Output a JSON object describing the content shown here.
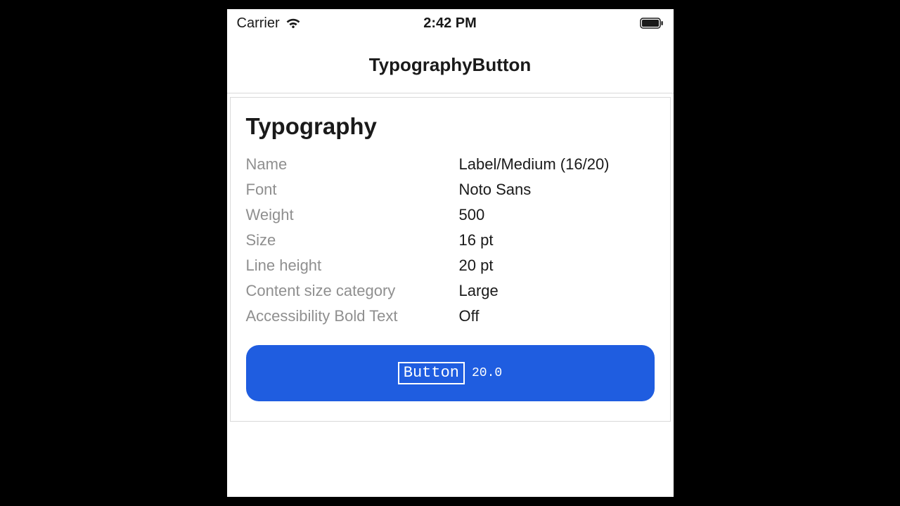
{
  "status_bar": {
    "carrier": "Carrier",
    "time": "2:42 PM"
  },
  "nav": {
    "title": "TypographyButton"
  },
  "card": {
    "title": "Typography"
  },
  "props": {
    "name": {
      "label": "Name",
      "value": "Label/Medium (16/20)"
    },
    "font": {
      "label": "Font",
      "value": "Noto Sans"
    },
    "weight": {
      "label": "Weight",
      "value": "500"
    },
    "size": {
      "label": "Size",
      "value": "16 pt"
    },
    "line_height": {
      "label": "Line height",
      "value": "20 pt"
    },
    "content_size_category": {
      "label": "Content size category",
      "value": "Large"
    },
    "accessibility_bold_text": {
      "label": "Accessibility Bold Text",
      "value": "Off"
    }
  },
  "sample_button": {
    "label": "Button",
    "annotation": "20.0"
  }
}
